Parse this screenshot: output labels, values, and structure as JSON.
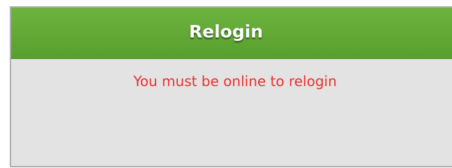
{
  "dialog": {
    "title": "Relogin",
    "message": "You must be online to relogin",
    "colors": {
      "header": "#62aa36",
      "title_text": "#ffffff",
      "body_background": "#e3e3e3",
      "message_text": "#e8312f",
      "border": "#aeaeae"
    }
  }
}
